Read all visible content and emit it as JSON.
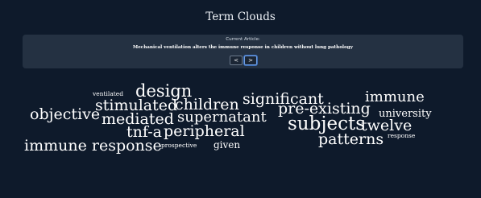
{
  "page": {
    "title": "Term Clouds"
  },
  "article": {
    "caption": "Current Article:",
    "title": "Mechanical ventilation alters the immune response in children without lung pathology"
  },
  "navigation": {
    "prev_label": "<",
    "next_label": ">"
  },
  "term_cloud": {
    "words": [
      "design",
      "ventilated",
      "significant",
      "immune",
      "stimulated",
      "children",
      "pre-existing",
      "university",
      "objective",
      "mediated",
      "supernatant",
      "subjects",
      "twelve",
      "tnf-a",
      "peripheral",
      "response",
      "patterns",
      "immune response",
      "prospective",
      "given"
    ]
  },
  "colors": {
    "background": "#0e1a2b",
    "panel": "#243142",
    "text": "#ffffff",
    "next_focus": "#6f9ee3"
  }
}
